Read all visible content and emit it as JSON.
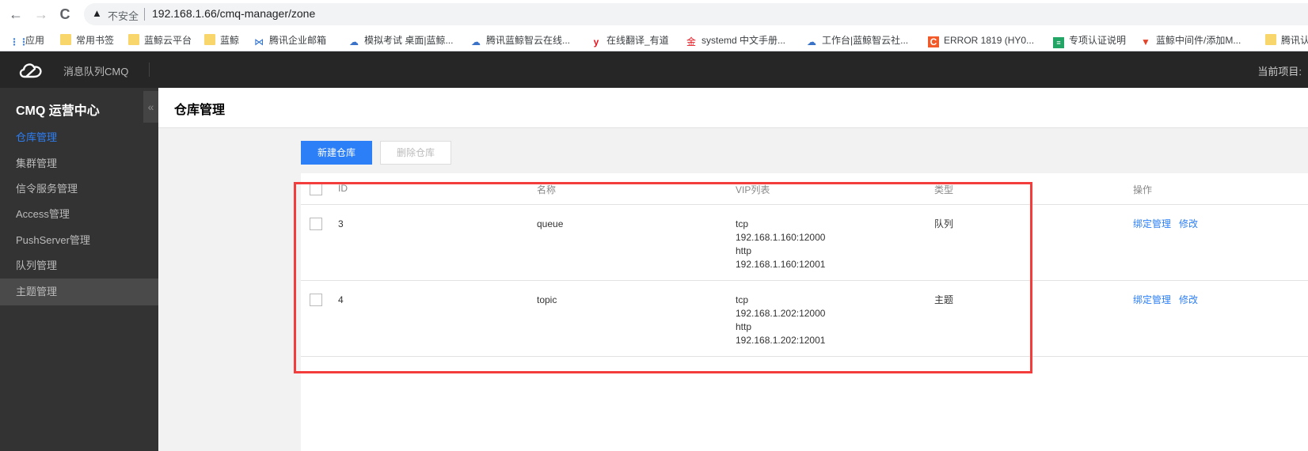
{
  "browser": {
    "back_icon": "←",
    "forward_icon": "→",
    "reload_icon": "C",
    "security_label": "不安全",
    "url": "192.168.1.66/cmq-manager/zone"
  },
  "bookmarks": [
    {
      "label": "应用",
      "icon": "apps-grid-icon"
    },
    {
      "label": "常用书签",
      "icon": "folder-icon"
    },
    {
      "label": "蓝鲸云平台",
      "icon": "folder-icon"
    },
    {
      "label": "蓝鲸",
      "icon": "folder-icon"
    },
    {
      "label": "腾讯企业邮箱",
      "icon": "tencent-mail-icon"
    },
    {
      "label": "模拟考试 桌面|蓝鲸...",
      "icon": "cloud-icon"
    },
    {
      "label": "腾讯蓝鲸智云在线...",
      "icon": "cloud-icon"
    },
    {
      "label": "在线翻译_有道",
      "icon": "youdao-icon"
    },
    {
      "label": "systemd 中文手册...",
      "icon": "jinshan-icon"
    },
    {
      "label": "工作台|蓝鲸智云社...",
      "icon": "cloud-icon"
    },
    {
      "label": "ERROR 1819 (HY0...",
      "icon": "csdn-icon"
    },
    {
      "label": "专项认证说明",
      "icon": "sheets-icon"
    },
    {
      "label": "蓝鲸中间件/添加M...",
      "icon": "gitlab-icon"
    },
    {
      "label": "腾讯认",
      "icon": "folder-icon"
    }
  ],
  "topbar": {
    "product": "消息队列CMQ",
    "current_project_label": "当前项目:"
  },
  "sidebar": {
    "title": "CMQ 运营中心",
    "collapse_icon": "«",
    "items": [
      {
        "label": "仓库管理",
        "active": true
      },
      {
        "label": "集群管理"
      },
      {
        "label": "信令服务管理"
      },
      {
        "label": "Access管理"
      },
      {
        "label": "PushServer管理"
      },
      {
        "label": "队列管理"
      },
      {
        "label": "主题管理",
        "hover": true
      }
    ]
  },
  "main": {
    "title": "仓库管理",
    "new_button": "新建仓库",
    "delete_button": "删除仓库",
    "table": {
      "headers": [
        "ID",
        "名称",
        "VIP列表",
        "类型",
        "操作"
      ],
      "rows": [
        {
          "id": "3",
          "name": "queue",
          "vip": [
            "tcp",
            "192.168.1.160:12000",
            "http",
            "192.168.1.160:12001"
          ],
          "type": "队列",
          "actions": [
            "绑定管理",
            "修改"
          ]
        },
        {
          "id": "4",
          "name": "topic",
          "vip": [
            "tcp",
            "192.168.1.202:12000",
            "http",
            "192.168.1.202:12001"
          ],
          "type": "主题",
          "actions": [
            "绑定管理",
            "修改"
          ]
        }
      ]
    }
  },
  "colors": {
    "accent": "#2c7ff7",
    "highlight_box": "#f33c3c",
    "sidebar_bg": "#333333",
    "topbar_bg": "#262626"
  }
}
